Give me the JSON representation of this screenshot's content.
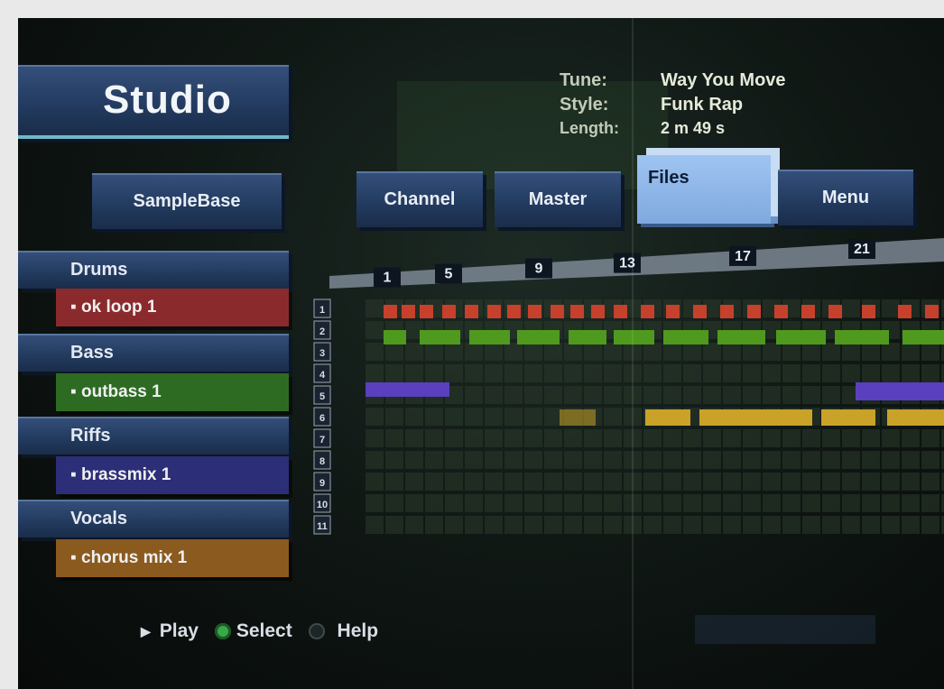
{
  "title": "Studio",
  "tune_info": {
    "tune_label": "Tune:",
    "tune_value": "Way You Move",
    "style_label": "Style:",
    "style_value": "Funk Rap",
    "length_label": "Length:",
    "length_value": "2 m 49 s"
  },
  "tabs": {
    "samplebase": "SampleBase",
    "channel": "Channel",
    "master": "Master",
    "files": "Files",
    "menu": "Menu"
  },
  "tracks": [
    {
      "category": "Drums",
      "sample": "▪ ok loop 1",
      "color": "#8a2a2c"
    },
    {
      "category": "Bass",
      "sample": "▪ outbass 1",
      "color": "#2d6b22"
    },
    {
      "category": "Riffs",
      "sample": "▪ brassmix 1",
      "color": "#2d2e78"
    },
    {
      "category": "Vocals",
      "sample": "▪ chorus mix 1",
      "color": "#8a5a1e"
    }
  ],
  "timeline": {
    "bar_markers": [
      "1",
      "5",
      "9",
      "13",
      "17",
      "21"
    ],
    "channel_numbers": [
      "1",
      "2",
      "3",
      "4",
      "5",
      "6",
      "7",
      "8",
      "9",
      "10",
      "11"
    ]
  },
  "help_bar": {
    "play_label": "Play",
    "select_label": "Select",
    "help_label": "Help"
  },
  "colors": {
    "drums_block": "#c7402b",
    "bass_block": "#4f9a1e",
    "riffs_block": "#5a3fbf",
    "vocals_block": "#c9a227",
    "panel_blue": "#2a4469",
    "files_tab": "#8eb8ec"
  }
}
